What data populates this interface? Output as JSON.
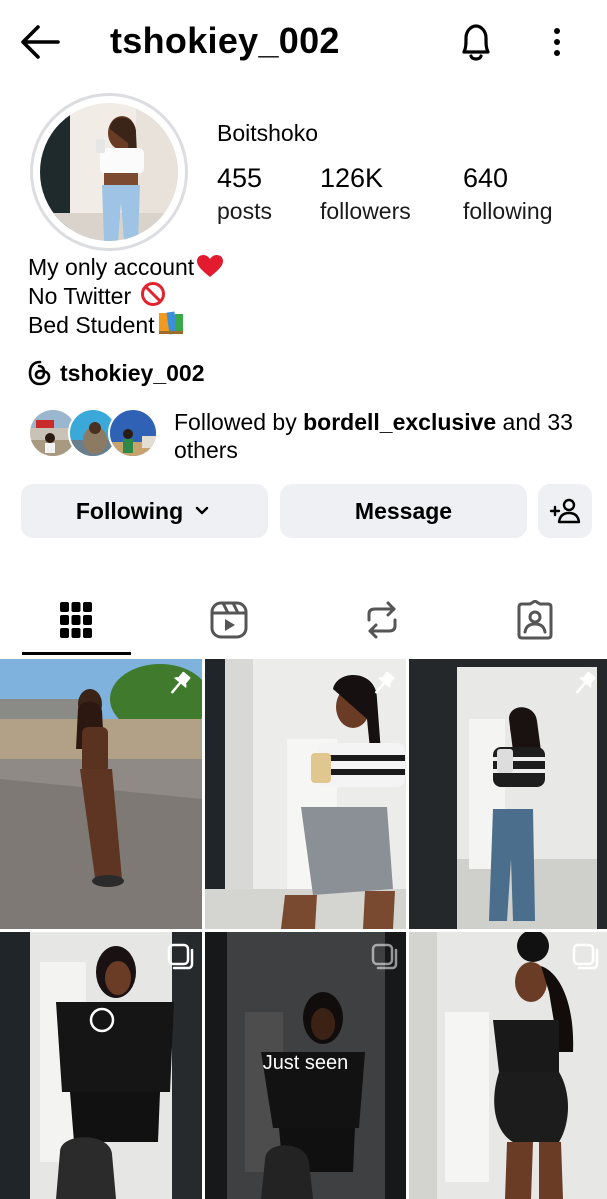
{
  "header": {
    "username": "tshokiey_002",
    "back_icon": "arrow-left-icon",
    "notification_icon": "bell-icon",
    "more_icon": "more-vertical-icon"
  },
  "profile": {
    "display_name": "Boitshoko",
    "stats": [
      {
        "value": "455",
        "label": "posts"
      },
      {
        "value": "126K",
        "label": "followers"
      },
      {
        "value": "640",
        "label": "following"
      }
    ],
    "bio": [
      "My only account",
      "No Twitter",
      "Bed Student"
    ],
    "bio_emojis": [
      "heart-icon",
      "no-entry-icon",
      "books-icon"
    ],
    "threads_handle": "tshokiey_002",
    "followed_by": {
      "prefix": "Followed by ",
      "name": "bordell_exclusive",
      "suffix": " and 33 others"
    }
  },
  "actions": {
    "following_label": "Following",
    "message_label": "Message",
    "add_person_icon": "add-person-icon"
  },
  "tabs": [
    "grid-icon",
    "reels-icon",
    "reposts-icon",
    "tagged-icon"
  ],
  "posts": [
    {
      "badge": "pin-icon",
      "overlay": ""
    },
    {
      "badge": "pin-icon",
      "overlay": ""
    },
    {
      "badge": "pin-icon",
      "overlay": ""
    },
    {
      "badge": "multi-photo-icon",
      "overlay": ""
    },
    {
      "badge": "multi-photo-icon",
      "overlay": "Just seen"
    },
    {
      "badge": "multi-photo-icon",
      "overlay": ""
    }
  ],
  "colors": {
    "button_bg": "#eff0f3",
    "text": "#000000",
    "ring": "#dcdde0"
  }
}
